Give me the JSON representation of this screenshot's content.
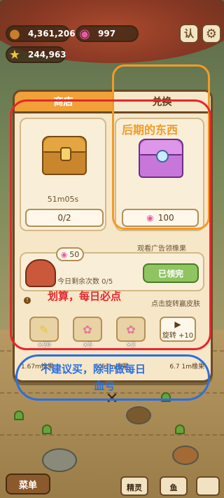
{
  "hud": {
    "coins": "4,361,206",
    "candy": "997",
    "stars": "244,963",
    "side_btn": "认",
    "coin_icon": "acorn-icon",
    "candy_icon": "lollipop-icon",
    "star_icon": "star-icon",
    "settings_icon": "gear-icon"
  },
  "tabs": {
    "shop": "商店",
    "exchange": "兑换"
  },
  "shop_chest": {
    "timer": "51m05s",
    "count": "0/2"
  },
  "exchange_chest": {
    "price": "100"
  },
  "daily": {
    "badge": "50",
    "remaining": "今日剩余次数 0/5",
    "claimed_label": "已领完",
    "watch_label": "观看广告领橡果"
  },
  "spin": {
    "hint": "点击旋转赢皮肤",
    "items": [
      {
        "icon": "feather-icon",
        "count": "×20"
      },
      {
        "icon": "fish-icon",
        "count": "×5"
      },
      {
        "icon": "fish-icon",
        "count": "×2"
      }
    ],
    "spin_label": "旋转 +10"
  },
  "stats": {
    "left": "1.67m橡果",
    "mid": "5.57m橡果",
    "right": "6.7 1m橡果"
  },
  "annotations": {
    "orange": "后期的东西",
    "red": "划算，每日必点",
    "blue_line1": "不建议买，除非做每日",
    "blue_line2": "血亏",
    "colors": {
      "red": "#e8262c",
      "orange": "#f19b27",
      "blue": "#2b6fe0"
    }
  },
  "bottom": {
    "menu": "菜单",
    "sprite": "精灵",
    "fish": "鱼"
  }
}
